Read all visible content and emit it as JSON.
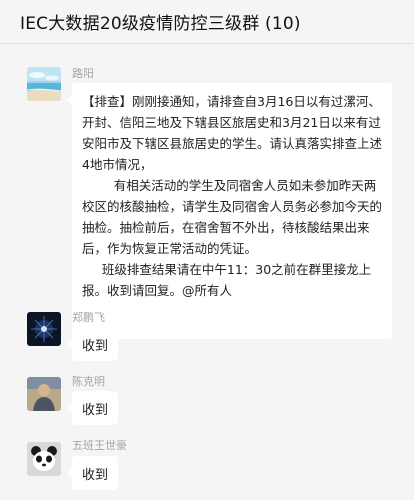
{
  "window": {
    "title": "IEC大数据20级疫情防控三级群 (10)"
  },
  "messages": [
    {
      "sender": "路阳",
      "avatar_icon": "beach-avatar-icon",
      "paragraphs": [
        "【排查】刚刚接通知，请排查自3月16日以有过漯河、开封、信阳三地及下辖县区旅居史和3月21日以来有过安阳市及下辖区县旅居史的学生。请认真落实排查上述4地市情况，",
        "        有相关活动的学生及同宿舍人员如未参加昨天两校区的核酸抽检，请学生及同宿舍人员务必参加今天的抽检。抽检前后，在宿舍暂不外出，待核酸结果出来后，作为恢复正常活动的凭证。",
        "     班级排查结果请在中午11：30之前在群里接龙上报。收到请回复。@所有人"
      ]
    },
    {
      "sender": "郑鹏飞",
      "avatar_icon": "dark-sparkle-avatar-icon",
      "text": "收到"
    },
    {
      "sender": "陈克明",
      "avatar_icon": "person-photo-avatar-icon",
      "text": "收到"
    },
    {
      "sender": "五班王世豪",
      "avatar_icon": "panda-avatar-icon",
      "text": "收到"
    }
  ]
}
